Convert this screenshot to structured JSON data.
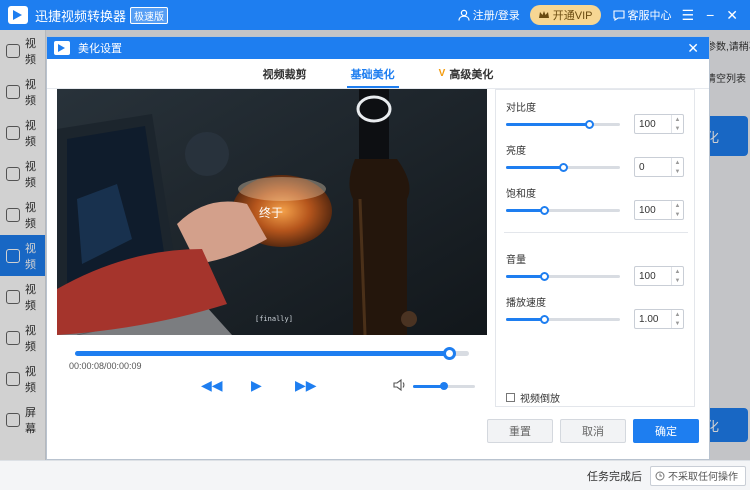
{
  "app": {
    "title": "迅捷视频转换器",
    "badge": "极速版",
    "login": "注册/登录",
    "vip": "开通VIP",
    "service": "客服中心",
    "accent": "#1e7ef0"
  },
  "sidebar": {
    "items": [
      {
        "label": "视频",
        "icon": "video-icon"
      },
      {
        "label": "视频",
        "icon": "audio-icon"
      },
      {
        "label": "视频",
        "icon": "play-icon"
      },
      {
        "label": "视频",
        "icon": "gif-icon"
      },
      {
        "label": "视频",
        "icon": "user-icon"
      },
      {
        "label": "视频",
        "icon": "film-icon",
        "active": true
      },
      {
        "label": "视频",
        "icon": "image-icon"
      },
      {
        "label": "视频",
        "icon": "chat-icon"
      },
      {
        "label": "视频",
        "icon": "compress-icon"
      },
      {
        "label": "屏幕",
        "icon": "screen-icon"
      }
    ]
  },
  "right_panel": {
    "text1": "参数,请稍再",
    "text2": "清空列表",
    "btn1": "化",
    "btn2": "化"
  },
  "bottom": {
    "task_label": "任务完成后",
    "task_select": "不采取任何操作"
  },
  "modal": {
    "title": "美化设置",
    "tabs": [
      {
        "label": "视频裁剪",
        "active": false,
        "vip": false
      },
      {
        "label": "基础美化",
        "active": true,
        "vip": false
      },
      {
        "label": "高级美化",
        "active": false,
        "vip": true
      }
    ],
    "video": {
      "time": "00:00:08/00:00:09",
      "progress": 0.95,
      "volume": 0.5,
      "caption": "[finally]"
    },
    "settings": {
      "contrast": {
        "label": "对比度",
        "value": "100",
        "level": 0.73
      },
      "brightness": {
        "label": "亮度",
        "value": "0",
        "level": 0.5
      },
      "saturation": {
        "label": "饱和度",
        "value": "100",
        "level": 0.33
      },
      "volume": {
        "label": "音量",
        "value": "100",
        "level": 0.33
      },
      "speed": {
        "label": "播放速度",
        "value": "1.00",
        "level": 0.33
      }
    },
    "reverse": "视频倒放",
    "buttons": {
      "reset": "重置",
      "cancel": "取消",
      "ok": "确定"
    }
  }
}
